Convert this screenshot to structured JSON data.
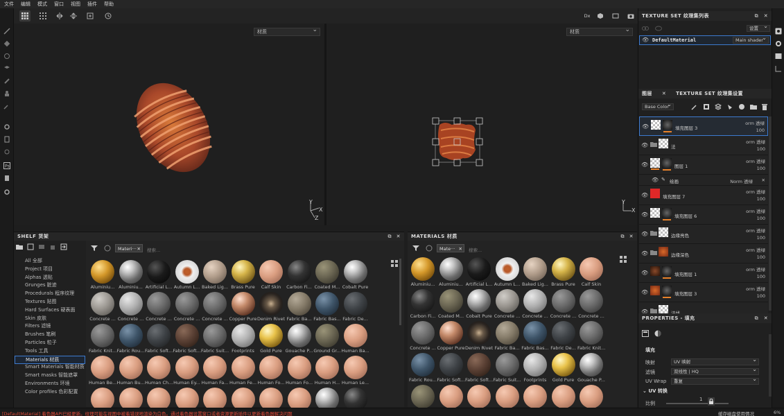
{
  "menubar": [
    "文件",
    "编辑",
    "模式",
    "窗口",
    "视图",
    "插件",
    "帮助"
  ],
  "viewports": {
    "left_select": "材质",
    "right_select": "材质",
    "axis_y": "Y",
    "axis_x": "X",
    "axis_z": "Z"
  },
  "toolbar_right": {
    "dx_label": "Dx"
  },
  "texture_set_list": {
    "title": "TEXTURE SET 纹理集列表",
    "settings_label": "设置",
    "material_name": "DefaultMaterial",
    "shader": "Main shader"
  },
  "layers": {
    "tab_layers": "图层",
    "tab_settings": "TEXTURE SET 纹理集设置",
    "channel": "Base Color",
    "rows": [
      {
        "name": "填充图层 3",
        "blend": "orm 透绿",
        "opacity": "100",
        "thumb": "checker",
        "mask": "dark",
        "selected": true
      },
      {
        "name": "法",
        "blend": "orm 透绿",
        "opacity": "100",
        "thumb": "checker",
        "mask": "none",
        "folder": true
      },
      {
        "name": "图层 1",
        "blend": "orm 透绿",
        "opacity": "100",
        "thumb": "checker-orange",
        "mask": "dark",
        "open": true
      },
      {
        "name": "绘画",
        "blend": "Norm 透绿",
        "opacity": "100",
        "sub": true
      },
      {
        "name": "填充图层 7",
        "blend": "orm 透绿",
        "opacity": "100",
        "thumb": "red"
      },
      {
        "name": "填充图层 6",
        "blend": "orm 透绿",
        "opacity": "100",
        "thumb": "checker",
        "mask": "dark"
      },
      {
        "name": "边缘亮色",
        "blend": "orm 透绿",
        "opacity": "100",
        "thumb": "checker",
        "folder": true
      },
      {
        "name": "边缘深色",
        "blend": "orm 透绿",
        "opacity": "100",
        "thumb": "rust",
        "folder": true
      },
      {
        "name": "填充图层 1",
        "blend": "orm 透绿",
        "opacity": "100",
        "thumb": "darkbrown",
        "mask": "dark"
      },
      {
        "name": "填充图层 3",
        "blend": "orm 透绿",
        "opacity": "100",
        "thumb": "rust",
        "mask": "dark"
      },
      {
        "name": "法线",
        "blend": "",
        "opacity": "",
        "thumb": "checker-orange",
        "folder": true
      }
    ]
  },
  "properties": {
    "title": "PROPERTIES - 填充",
    "section": "填充",
    "rows": [
      {
        "label": "映射",
        "value": "UV 映射"
      },
      {
        "label": "滤镜",
        "value": "双线性 | HQ"
      },
      {
        "label": "UV Wrap",
        "value": "重复"
      }
    ],
    "uv_section": "UV 转换",
    "scale_label": "比例",
    "scale_value": "1"
  },
  "shelf": {
    "title": "SHELF 货架",
    "search_tag": "Materi···",
    "search_placeholder": "搜索...",
    "categories": [
      "All 全部",
      "Project 项目",
      "Alphas 透贴",
      "Grunges 脏迹",
      "Procedurals 程序纹理",
      "Textures 贴图",
      "Hard Surfaces 硬表面",
      "Skin 皮肤",
      "Filters 滤镜",
      "Brushes 笔刷",
      "Particles 粒子",
      "Tools 工具",
      "Materials 材质",
      "Smart Materials 智能材质",
      "Smart masks 智能遮罩",
      "Environments 环境",
      "Color profiles 色彩配置"
    ],
    "selected_category": "Materials 材质",
    "materials": [
      {
        "label": "Aluminiu...",
        "kind": "honeycomb"
      },
      {
        "label": "Aluminiu...",
        "kind": "silver"
      },
      {
        "label": "Artificial L...",
        "kind": "black"
      },
      {
        "label": "Autumn L...",
        "kind": "leaf"
      },
      {
        "label": "Baked Lig...",
        "kind": "beige"
      },
      {
        "label": "Brass Pure",
        "kind": "brass"
      },
      {
        "label": "Calf Skin",
        "kind": "skin"
      },
      {
        "label": "Carbon Fi...",
        "kind": "carbon"
      },
      {
        "label": "Coated M...",
        "kind": "olive"
      },
      {
        "label": "Cobalt Pure",
        "kind": "silver"
      },
      {
        "label": "Concrete ...",
        "kind": "concrete"
      },
      {
        "label": "Concrete ...",
        "kind": "lightgrey"
      },
      {
        "label": "Concrete ...",
        "kind": "grey"
      },
      {
        "label": "Concrete ...",
        "kind": "grey"
      },
      {
        "label": "Concrete ...",
        "kind": "grey"
      },
      {
        "label": "Copper Pure",
        "kind": "copper"
      },
      {
        "label": "Denim Rivet",
        "kind": "rivet"
      },
      {
        "label": "Fabric Ba...",
        "kind": "fabric"
      },
      {
        "label": "Fabric Bas...",
        "kind": "blue"
      },
      {
        "label": "Fabric De...",
        "kind": "darkgrey"
      },
      {
        "label": "Fabric Knit...",
        "kind": "grey"
      },
      {
        "label": "Fabric Rou...",
        "kind": "blue"
      },
      {
        "label": "Fabric Soft...",
        "kind": "darkgrey"
      },
      {
        "label": "Fabric Soft...",
        "kind": "brown"
      },
      {
        "label": "Fabric Suit...",
        "kind": "grey"
      },
      {
        "label": "Footprints",
        "kind": "lightgrey"
      },
      {
        "label": "Gold Pure",
        "kind": "gold"
      },
      {
        "label": "Gouache P...",
        "kind": "silver"
      },
      {
        "label": "Ground Gr...",
        "kind": "olive"
      },
      {
        "label": "Human Ba...",
        "kind": "skin"
      },
      {
        "label": "Human Be...",
        "kind": "skin"
      },
      {
        "label": "Human Bu...",
        "kind": "skin"
      },
      {
        "label": "Human Ch...",
        "kind": "skin"
      },
      {
        "label": "Human Ey...",
        "kind": "skin"
      },
      {
        "label": "Human Fa...",
        "kind": "skin"
      },
      {
        "label": "Human Fe...",
        "kind": "skin"
      },
      {
        "label": "Human Fo...",
        "kind": "skin"
      },
      {
        "label": "Human Fo...",
        "kind": "skin"
      },
      {
        "label": "Human H...",
        "kind": "skin"
      },
      {
        "label": "Human Le...",
        "kind": "skin"
      },
      {
        "label": "",
        "kind": "skin"
      },
      {
        "label": "",
        "kind": "skin"
      },
      {
        "label": "",
        "kind": "skin"
      },
      {
        "label": "",
        "kind": "skin"
      },
      {
        "label": "",
        "kind": "skin"
      },
      {
        "label": "",
        "kind": "skin"
      },
      {
        "label": "",
        "kind": "skin"
      },
      {
        "label": "",
        "kind": "skin"
      },
      {
        "label": "",
        "kind": "silver"
      },
      {
        "label": "",
        "kind": "carbon"
      }
    ]
  },
  "materials_panel": {
    "title": "MATERIALS 材质",
    "search_tag": "Mate···",
    "search_placeholder": "搜索...",
    "items": [
      {
        "label": "Aluminiu...",
        "kind": "honeycomb"
      },
      {
        "label": "Aluminiu...",
        "kind": "silver"
      },
      {
        "label": "Artificial L...",
        "kind": "black"
      },
      {
        "label": "Autumn L...",
        "kind": "leaf"
      },
      {
        "label": "Baked Lig...",
        "kind": "beige"
      },
      {
        "label": "Brass Pure",
        "kind": "brass"
      },
      {
        "label": "Calf Skin",
        "kind": "skin"
      },
      {
        "label": "Carbon Fi...",
        "kind": "carbon"
      },
      {
        "label": "Coated M...",
        "kind": "olive"
      },
      {
        "label": "Cobalt Pure",
        "kind": "silver"
      },
      {
        "label": "Concrete ...",
        "kind": "concrete"
      },
      {
        "label": "Concrete ...",
        "kind": "lightgrey"
      },
      {
        "label": "Concrete ...",
        "kind": "grey"
      },
      {
        "label": "Concrete ...",
        "kind": "grey"
      },
      {
        "label": "Concrete ...",
        "kind": "grey"
      },
      {
        "label": "Copper Pure",
        "kind": "copper"
      },
      {
        "label": "Denim Rivet",
        "kind": "rivet"
      },
      {
        "label": "Fabric Ba...",
        "kind": "fabric"
      },
      {
        "label": "Fabric Bas...",
        "kind": "blue"
      },
      {
        "label": "Fabric De...",
        "kind": "darkgrey"
      },
      {
        "label": "Fabric Knit...",
        "kind": "grey"
      },
      {
        "label": "Fabric Rou...",
        "kind": "blue"
      },
      {
        "label": "Fabric Soft...",
        "kind": "darkgrey"
      },
      {
        "label": "Fabric Soft...",
        "kind": "brown"
      },
      {
        "label": "Fabric Suit...",
        "kind": "grey"
      },
      {
        "label": "Footprints",
        "kind": "lightgrey"
      },
      {
        "label": "Gold Pure",
        "kind": "gold"
      },
      {
        "label": "Gouache P...",
        "kind": "silver"
      },
      {
        "label": "",
        "kind": "olive"
      },
      {
        "label": "",
        "kind": "skin"
      },
      {
        "label": "",
        "kind": "skin"
      },
      {
        "label": "",
        "kind": "skin"
      },
      {
        "label": "",
        "kind": "skin"
      },
      {
        "label": "",
        "kind": "skin"
      },
      {
        "label": "",
        "kind": "skin"
      }
    ]
  },
  "status": {
    "message": "[DefaultMaterial] 着色器API已经更新。纹理可能在视图中被着错误地渲染为白色。通过着色器设置窗口或者资源更新插件以更新着色器解决问题",
    "right_text": "缓存磁盘使用情况",
    "percent": "6%"
  },
  "colors": {
    "accent": "#3d7bd0",
    "orange": "#e8822a",
    "error": "#e04a3a"
  }
}
